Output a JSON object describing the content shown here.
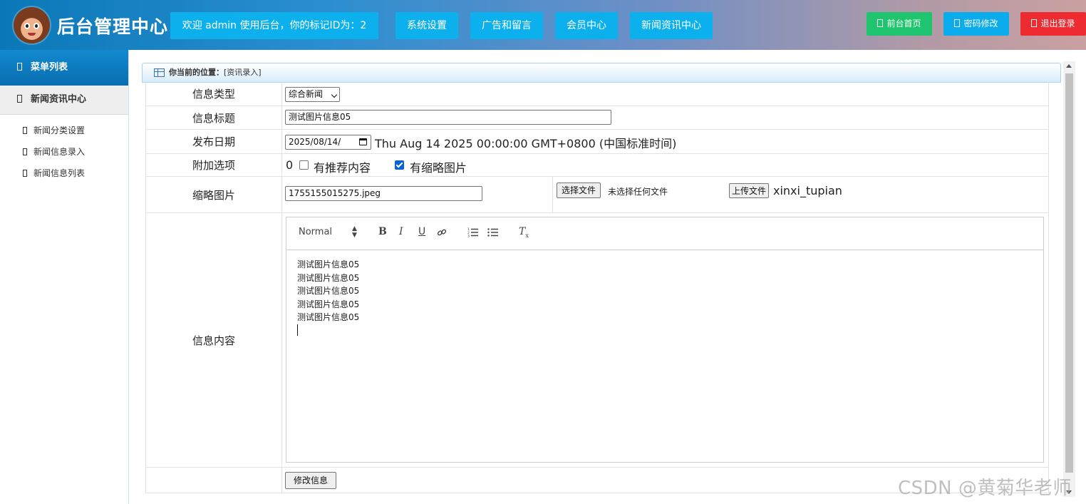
{
  "header": {
    "app_title": "后台管理中心",
    "welcome": "欢迎 admin 使用后台，你的标记ID为：2",
    "nav": [
      "系统设置",
      "广告和留言",
      "会员中心",
      "新闻资讯中心"
    ],
    "home_label": "前台首页",
    "password_label": "密码修改",
    "logout_label": "退出登录",
    "colors": {
      "nav_bg": "#0cb0ec",
      "home_bg": "#1fc46e",
      "password_bg": "#0aacec",
      "logout_bg": "#ee2b31"
    }
  },
  "sidebar": {
    "menu_title": "菜单列表",
    "group_title": "新闻资讯中心",
    "items": [
      "新闻分类设置",
      "新闻信息录入",
      "新闻信息列表"
    ]
  },
  "breadcrumb": {
    "label": "你当前的位置：",
    "value": "[资讯录入]"
  },
  "form": {
    "type_label": "信息类型",
    "type_value": "综合新闻",
    "title_label": "信息标题",
    "title_value": "测试图片信息05",
    "date_label": "发布日期",
    "date_value": "2025/08/14/",
    "date_display": "Thu Aug 14 2025 00:00:00 GMT+0800 (中国标准时间)",
    "options_label": "附加选项",
    "options_prefix": "0",
    "option_recommend": "有推荐内容",
    "option_recommend_checked": false,
    "option_thumb": "有缩略图片",
    "option_thumb_checked": true,
    "thumb_label": "缩略图片",
    "thumb_value": "1755155015275.jpeg",
    "choose_file_label": "选择文件",
    "no_file_text": "未选择任何文件",
    "upload_label": "上传文件",
    "upload_field_name": "xinxi_tupian",
    "content_label": "信息内容",
    "editor": {
      "header_select": "Normal",
      "bold": "B",
      "italic": "I",
      "underline": "U",
      "clean": "T",
      "clean_sub": "x",
      "lines": [
        "测试图片信息05",
        "测试图片信息05",
        "测试图片信息05",
        "测试图片信息05",
        "测试图片信息05"
      ]
    },
    "submit_label": "修改信息"
  },
  "watermark": "CSDN @黄菊华老师",
  "icons": {
    "logo": "cartoon-boy-avatar",
    "nav_squares": "square-icon",
    "table_icon": "table-icon",
    "link": "link-icon",
    "ordered_list": "ordered-list-icon",
    "bullet_list": "bullet-list-icon",
    "calendar": "calendar-icon"
  }
}
